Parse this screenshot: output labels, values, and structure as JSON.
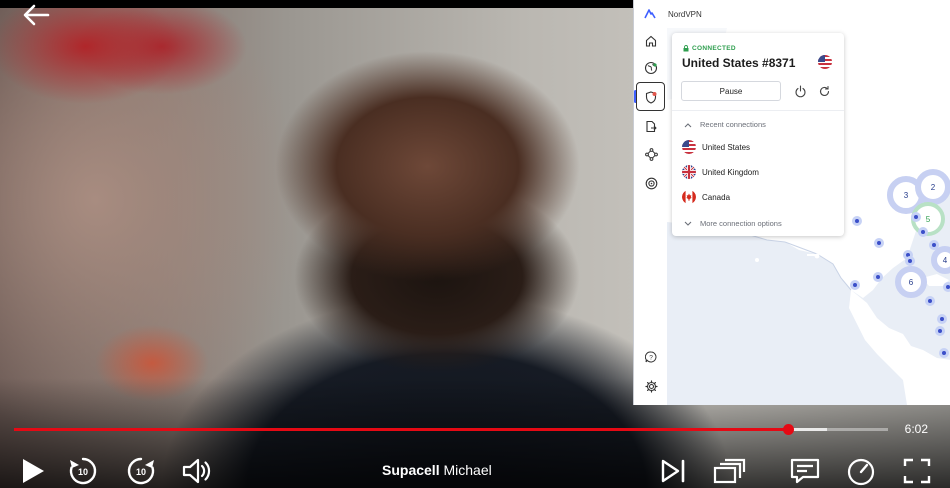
{
  "player": {
    "show_title": "Supacell",
    "episode_title": "Michael",
    "time_remaining": "6:02",
    "progress_fraction": 0.886,
    "buffer_fraction": 0.93,
    "skip_back_seconds": "10",
    "skip_forward_seconds": "10",
    "accent_color": "#e50914",
    "controls": [
      "back-arrow-icon",
      "play-icon",
      "rewind-10-icon",
      "forward-10-icon",
      "volume-icon",
      "next-episode-icon",
      "episodes-icon",
      "subtitles-icon",
      "speed-icon",
      "fullscreen-icon"
    ]
  },
  "vpn": {
    "app_title": "NordVPN",
    "status": "CONNECTED",
    "server": "United States #8371",
    "pause_label": "Pause",
    "recent_label": "Recent connections",
    "recent": [
      {
        "name": "United States",
        "flag": "us-flag-icon"
      },
      {
        "name": "United Kingdom",
        "flag": "uk-flag-icon"
      },
      {
        "name": "Canada",
        "flag": "canada-flag-icon"
      }
    ],
    "more_label": "More connection options",
    "status_color": "#2e9e4e",
    "map_clusters": [
      "3",
      "2",
      "5",
      "4",
      "6"
    ],
    "rail_icons": [
      "home-icon",
      "globe-icon",
      "shield-icon",
      "file-share-icon",
      "meshnet-icon",
      "target-icon",
      "help-icon",
      "settings-icon"
    ]
  }
}
